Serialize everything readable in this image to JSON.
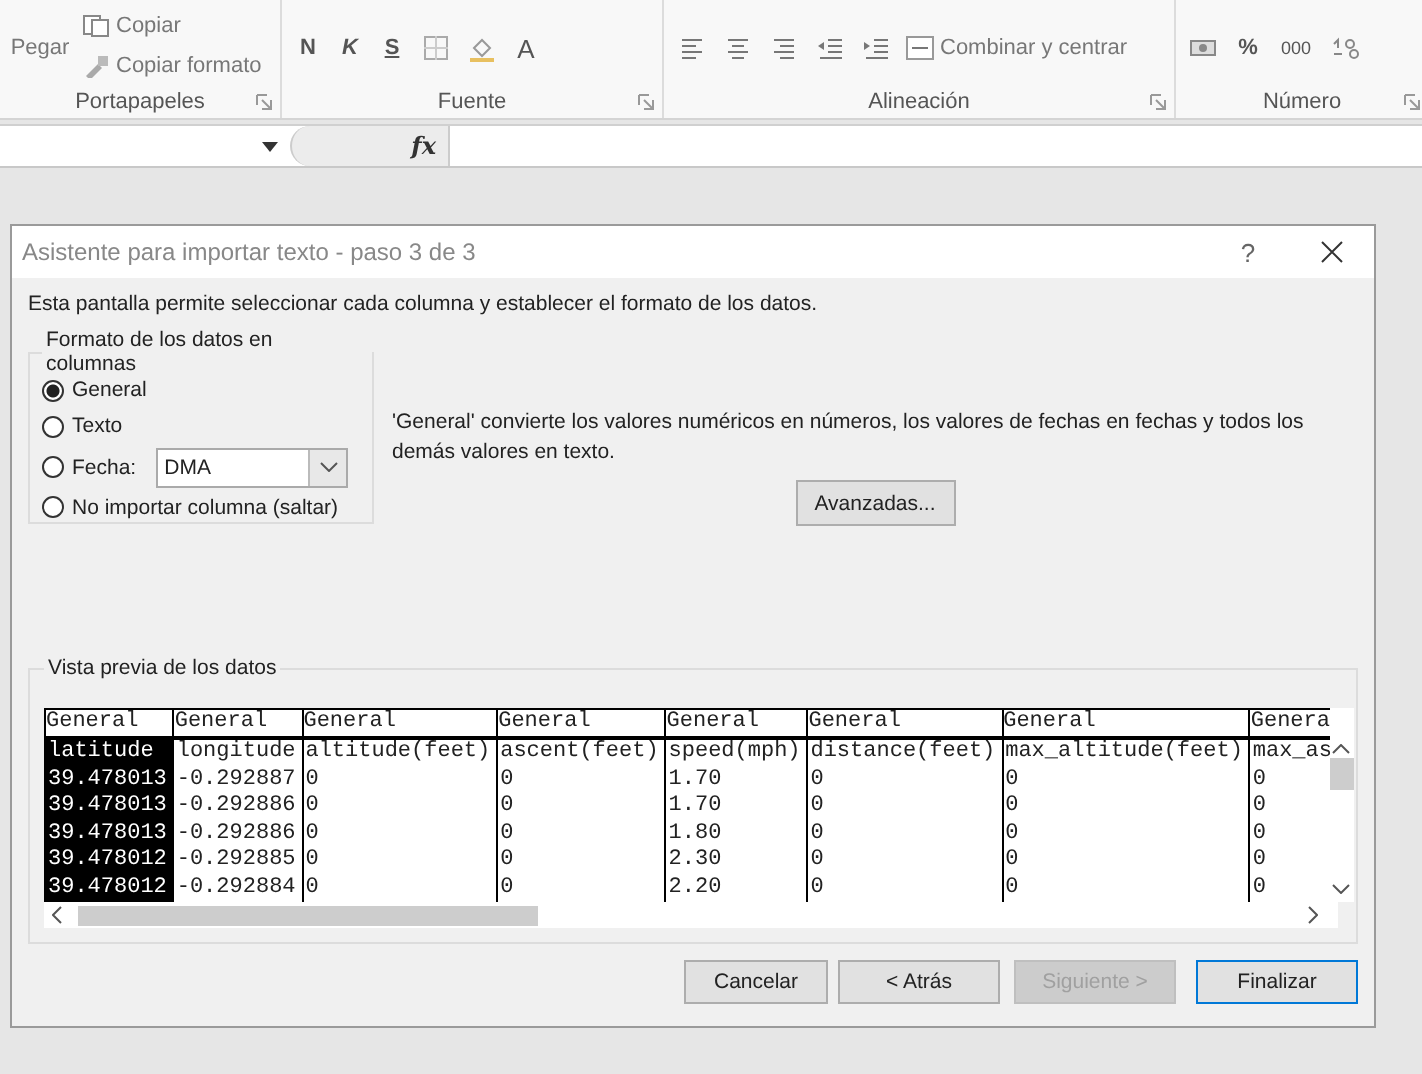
{
  "ribbon": {
    "clipboard": {
      "paste": "Pegar",
      "copy": "Copiar",
      "format_painter": "Copiar formato",
      "label": "Portapapeles"
    },
    "font": {
      "bold": "N",
      "italic": "K",
      "underline": "S",
      "font_color": "A",
      "label": "Fuente"
    },
    "alignment": {
      "merge": "Combinar y centrar",
      "label": "Alineación"
    },
    "number": {
      "percent": "%",
      "thousands": "000",
      "label": "Número"
    }
  },
  "formula_bar": {
    "fx": "fx"
  },
  "dialog": {
    "title": "Asistente para importar texto - paso 3 de 3",
    "help": "?",
    "intro": "Esta pantalla permite seleccionar cada columna y establecer el formato de los datos.",
    "format_group": {
      "label": "Formato de los datos en columnas",
      "options": [
        {
          "label": "General",
          "kind": "plain",
          "selected": true
        },
        {
          "label": "Texto",
          "kind": "plain",
          "selected": false
        },
        {
          "label": "Fecha:",
          "kind": "date",
          "selected": false,
          "value": "DMA"
        },
        {
          "label": "No importar columna (saltar)",
          "kind": "plain",
          "selected": false
        }
      ]
    },
    "description": "'General' convierte los valores numéricos en números, los valores de fechas en fechas y todos los demás valores en texto.",
    "advanced_button": "Avanzadas...",
    "preview": {
      "label": "Vista previa de los datos",
      "columns": [
        {
          "format": "General",
          "selected": true
        },
        {
          "format": "General",
          "selected": false
        },
        {
          "format": "General",
          "selected": false
        },
        {
          "format": "General",
          "selected": false
        },
        {
          "format": "General",
          "selected": false
        },
        {
          "format": "General",
          "selected": false
        },
        {
          "format": "General",
          "selected": false
        },
        {
          "format": "Genera",
          "selected": false
        }
      ],
      "rows": [
        [
          "latitude",
          "longitude",
          "altitude(feet)",
          "ascent(feet)",
          "speed(mph)",
          "distance(feet)",
          "max_altitude(feet)",
          "max_as"
        ],
        [
          "39.478013",
          "-0.292887",
          "0",
          "0",
          "1.70",
          "0",
          "0",
          "0"
        ],
        [
          "39.478013",
          "-0.292886",
          "0",
          "0",
          "1.70",
          "0",
          "0",
          "0"
        ],
        [
          "39.478013",
          "-0.292886",
          "0",
          "0",
          "1.80",
          "0",
          "0",
          "0"
        ],
        [
          "39.478012",
          "-0.292885",
          "0",
          "0",
          "2.30",
          "0",
          "0",
          "0"
        ],
        [
          "39.478012",
          "-0.292884",
          "0",
          "0",
          "2.20",
          "0",
          "0",
          "0"
        ]
      ]
    },
    "buttons": [
      {
        "label": "Cancelar",
        "kind": "normal",
        "disabled": false
      },
      {
        "label": "< Atrás",
        "kind": "normal",
        "disabled": false
      },
      {
        "label": "Siguiente >",
        "kind": "normal",
        "disabled": true
      },
      {
        "label": "Finalizar",
        "kind": "default",
        "disabled": false
      }
    ]
  }
}
